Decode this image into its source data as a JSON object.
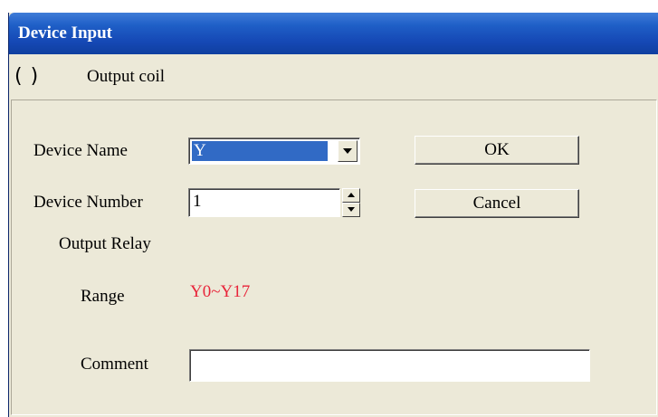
{
  "window": {
    "title": "Device Input"
  },
  "instruction": {
    "symbol": "( )",
    "label": "Output coil"
  },
  "form": {
    "device_name": {
      "label": "Device Name",
      "value": "Y"
    },
    "device_number": {
      "label": "Device Number",
      "value": "1"
    },
    "device_type": "Output Relay",
    "range": {
      "label": "Range",
      "value": "Y0~Y17",
      "color": "#e8253a"
    },
    "comment": {
      "label": "Comment",
      "value": ""
    }
  },
  "buttons": {
    "ok": "OK",
    "cancel": "Cancel"
  },
  "icons": {
    "combo_arrow": "chevron-down-icon",
    "spin_up": "arrow-up-icon",
    "spin_down": "arrow-down-icon"
  }
}
